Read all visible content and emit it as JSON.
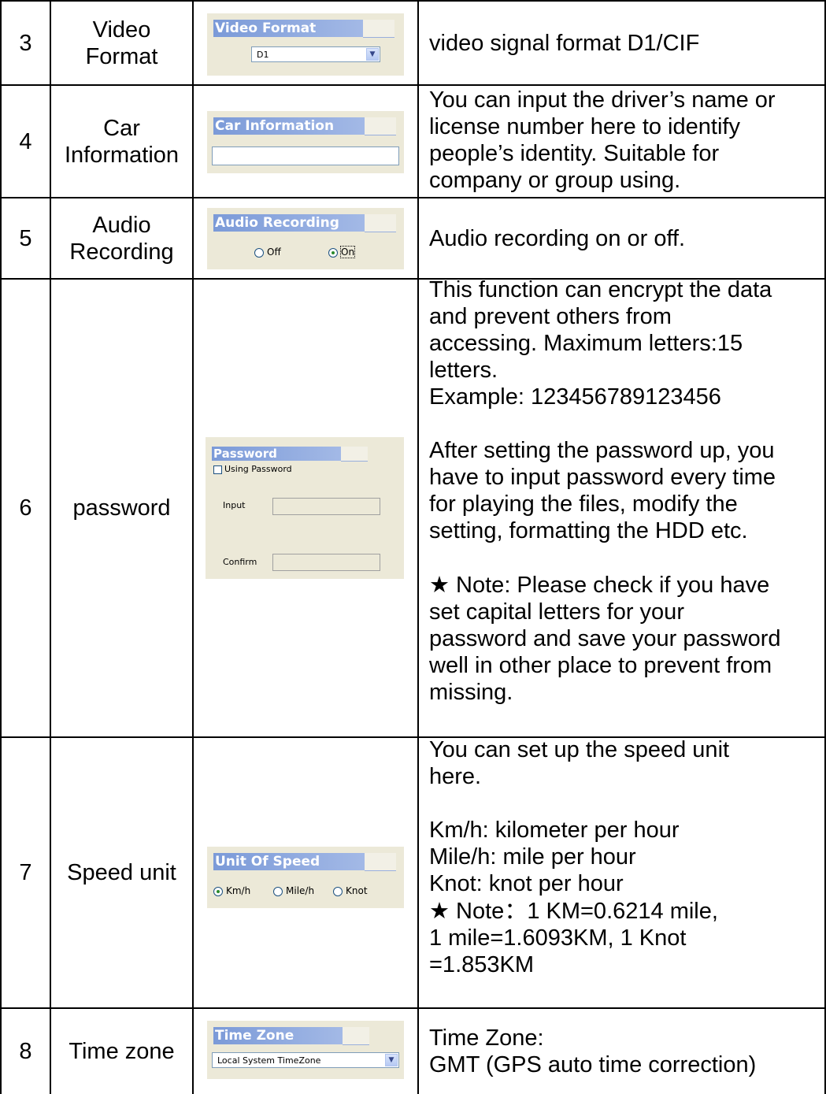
{
  "rows": [
    {
      "num": "3",
      "name_line1": "Video",
      "name_line2": "Format",
      "panel": {
        "title": "Video Format",
        "select_value": "D1"
      },
      "desc": [
        "video signal format D1/CIF"
      ]
    },
    {
      "num": "4",
      "name_line1": "Car",
      "name_line2": "Information",
      "panel": {
        "title": "Car Information"
      },
      "desc": [
        "You can input the driver’s name or",
        "license number here to identify",
        "people’s identity. Suitable for",
        "company or group using."
      ]
    },
    {
      "num": "5",
      "name_line1": "Audio",
      "name_line2": "Recording",
      "panel": {
        "title": "Audio Recording",
        "opt_off": "Off",
        "opt_on": "On"
      },
      "desc": [
        "Audio recording on or off."
      ]
    },
    {
      "num": "6",
      "name": "password",
      "panel": {
        "title": "Password",
        "checkbox_label": "Using Password",
        "input_label": "Input",
        "confirm_label": "Confirm"
      },
      "desc_block1": [
        "This function can encrypt the data",
        "and prevent others from",
        "accessing. Maximum letters:15",
        "letters.",
        "Example: 123456789123456"
      ],
      "desc_block2": [
        "After setting the password up, you",
        "have to input password every time",
        "for playing the files, modify the",
        "setting, formatting the HDD etc."
      ],
      "note_star": "★",
      "note_line1": " Note: Please check if you have",
      "desc_block3": [
        "set capital letters for your",
        "password and save your password",
        "well in other place to prevent from",
        "missing."
      ]
    },
    {
      "num": "7",
      "name": "Speed unit",
      "panel": {
        "title": "Unit Of Speed",
        "opt_kmh": "Km/h",
        "opt_mileh": "Mile/h",
        "opt_knot": "Knot"
      },
      "desc_block1": [
        "You can set up the speed unit",
        "here."
      ],
      "desc_block2": [
        "Km/h: kilometer per hour",
        "Mile/h: mile per hour",
        "Knot: knot per hour"
      ],
      "note_star": "★",
      "note_line1": " Note：1 KM=0.6214 mile,",
      "desc_block3": [
        "1 mile=1.6093KM, 1 Knot",
        "=1.853KM"
      ]
    },
    {
      "num": "8",
      "name": "Time zone",
      "panel": {
        "title": "Time Zone",
        "select_value": "Local System TimeZone"
      },
      "desc": [
        "Time Zone:",
        "GMT (GPS auto time correction)"
      ]
    }
  ]
}
